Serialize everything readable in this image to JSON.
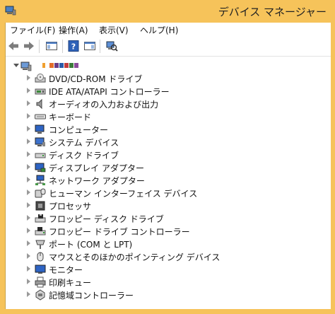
{
  "window": {
    "title": "デバイス マネージャー"
  },
  "menu": [
    {
      "label": "ファイル(F)"
    },
    {
      "label": "操作(A)"
    },
    {
      "label": "表示(V)"
    },
    {
      "label": "ヘルプ(H)"
    }
  ],
  "toolbar": [
    {
      "icon": "back-arrow-icon"
    },
    {
      "icon": "forward-arrow-icon"
    },
    {
      "icon": "show-hide-console-tree-icon"
    },
    {
      "icon": "help-icon"
    },
    {
      "icon": "show-action-pane-icon"
    },
    {
      "icon": "scan-hardware-changes-icon"
    }
  ],
  "tree": {
    "root": {
      "icon": "computer-icon",
      "label_redacted": true
    },
    "items": [
      {
        "label": "DVD/CD-ROM ドライブ",
        "icon": "dvd-drive-icon"
      },
      {
        "label": "IDE ATA/ATAPI コントローラー",
        "icon": "ide-controller-icon"
      },
      {
        "label": "オーディオの入力および出力",
        "icon": "speaker-icon"
      },
      {
        "label": "キーボード",
        "icon": "keyboard-icon"
      },
      {
        "label": "コンピューター",
        "icon": "computer-monitor-icon"
      },
      {
        "label": "システム デバイス",
        "icon": "system-device-icon"
      },
      {
        "label": "ディスク ドライブ",
        "icon": "disk-drive-icon"
      },
      {
        "label": "ディスプレイ アダプター",
        "icon": "display-adapter-icon"
      },
      {
        "label": "ネットワーク アダプター",
        "icon": "network-adapter-icon"
      },
      {
        "label": "ヒューマン インターフェイス デバイス",
        "icon": "hid-icon"
      },
      {
        "label": "プロセッサ",
        "icon": "processor-icon"
      },
      {
        "label": "フロッピー ディスク ドライブ",
        "icon": "floppy-drive-icon"
      },
      {
        "label": "フロッピー ドライブ コントローラー",
        "icon": "floppy-controller-icon"
      },
      {
        "label": "ポート (COM と LPT)",
        "icon": "port-icon"
      },
      {
        "label": "マウスとそのほかのポインティング デバイス",
        "icon": "mouse-icon"
      },
      {
        "label": "モニター",
        "icon": "monitor-icon"
      },
      {
        "label": "印刷キュー",
        "icon": "printer-icon"
      },
      {
        "label": "記憶域コントローラー",
        "icon": "storage-controller-icon"
      }
    ]
  },
  "colors": {
    "titlebar": "#f6c35a",
    "client": "#ffffff"
  }
}
